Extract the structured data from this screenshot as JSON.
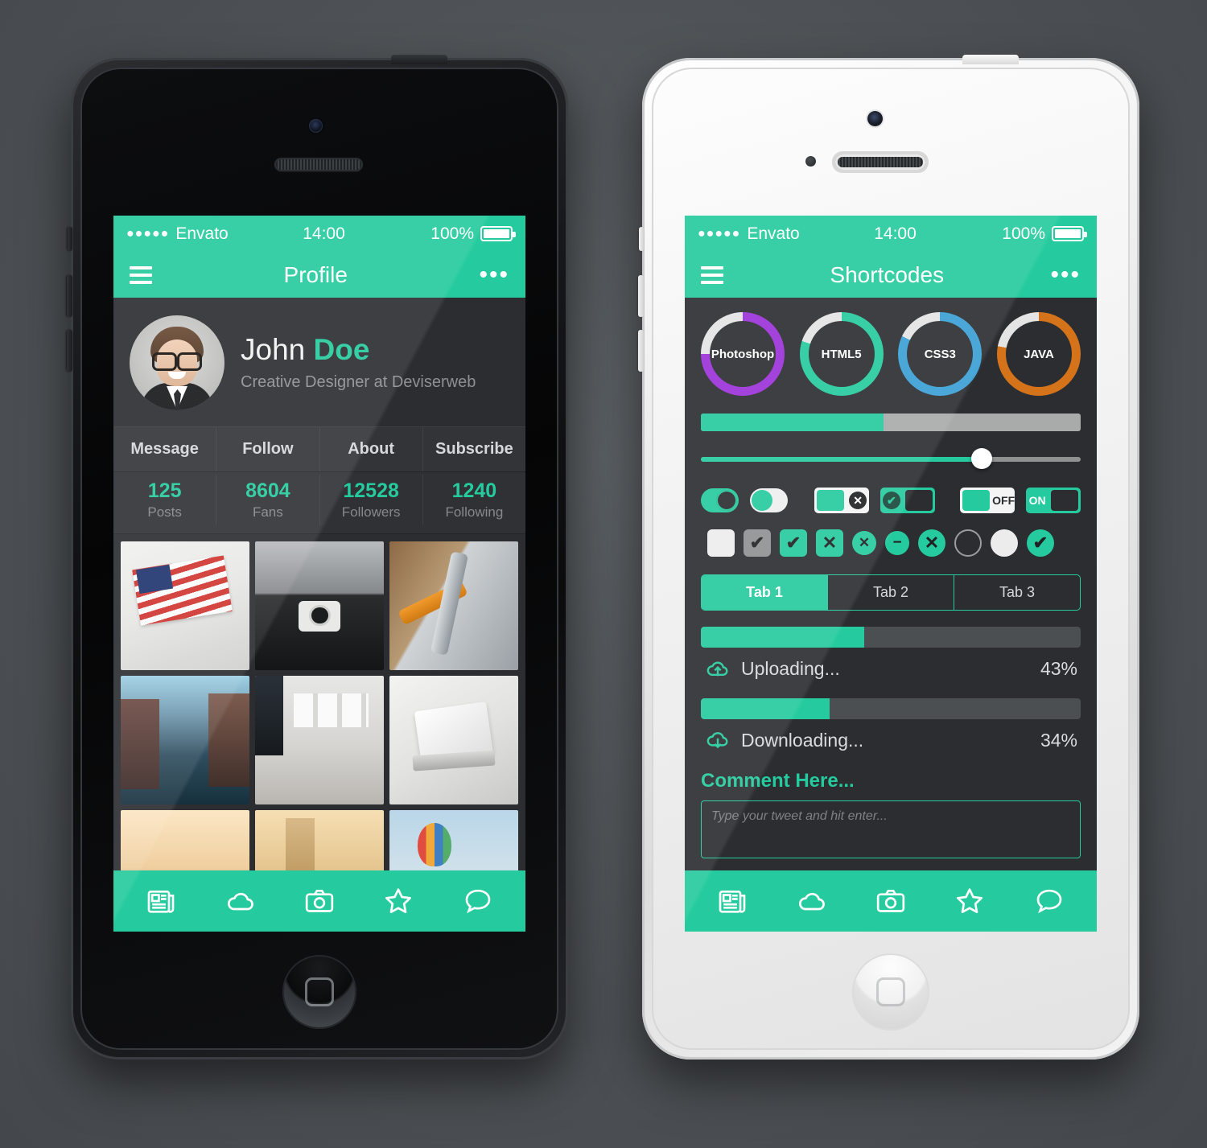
{
  "theme": {
    "accent": "#25cb9e",
    "screen_bg": "#2b2d30",
    "page_bg": "#4d5155"
  },
  "phone_left": {
    "status_bar": {
      "signal_dots": "●●●●●",
      "carrier": "Envato",
      "time": "14:00",
      "battery_pct": "100%"
    },
    "nav": {
      "menu_icon": "hamburger-icon",
      "title": "Profile",
      "more_icon": "more-dots-icon"
    },
    "profile": {
      "name_first": "John ",
      "name_last": "Doe",
      "role": "Creative Designer at Deviserweb",
      "actions": [
        "Message",
        "Follow",
        "About",
        "Subscribe"
      ],
      "stats": [
        {
          "num": "125",
          "label": "Posts"
        },
        {
          "num": "8604",
          "label": "Fans"
        },
        {
          "num": "12528",
          "label": "Followers"
        },
        {
          "num": "1240",
          "label": "Following"
        }
      ]
    },
    "photos": [
      "american-flag",
      "photographer",
      "bicycle",
      "city-street",
      "office-desk",
      "laptop-symbol",
      "crowd-sunset",
      "tower-sunset",
      "hot-air-balloon"
    ],
    "tabbar": [
      "newspaper-icon",
      "cloud-icon",
      "camera-icon",
      "star-icon",
      "chat-icon"
    ]
  },
  "phone_right": {
    "status_bar": {
      "signal_dots": "●●●●●",
      "carrier": "Envato",
      "time": "14:00",
      "battery_pct": "100%"
    },
    "nav": {
      "menu_icon": "hamburger-icon",
      "title": "Shortcodes",
      "more_icon": "more-dots-icon"
    },
    "rings": [
      {
        "label": "Photoshop",
        "percent": 75,
        "color": "#9b30d9"
      },
      {
        "label": "HTML5",
        "percent": 80,
        "color": "#25cb9e"
      },
      {
        "label": "CSS3",
        "percent": 82,
        "color": "#3a9fd4"
      },
      {
        "label": "JAVA",
        "percent": 78,
        "color": "#d4731a"
      }
    ],
    "progress_bar": {
      "percent": 48
    },
    "slider": {
      "percent": 74
    },
    "toggles": [
      {
        "type": "pill",
        "state": "on"
      },
      {
        "type": "pill",
        "state": "off"
      },
      {
        "type": "square",
        "bg": "light",
        "block": "green",
        "glyph": "✖",
        "label": ""
      },
      {
        "type": "square",
        "bg": "green",
        "block": "dark",
        "glyph": "✔",
        "label": ""
      },
      {
        "type": "square",
        "bg": "light",
        "block": "green",
        "glyph": "",
        "label": "OFF"
      },
      {
        "type": "square",
        "bg": "green",
        "block": "dark",
        "glyph": "",
        "label": "ON"
      }
    ],
    "checkboxes": [
      {
        "style": "white",
        "glyph": ""
      },
      {
        "style": "gray",
        "glyph": "✔"
      },
      {
        "style": "green",
        "glyph": "✔"
      },
      {
        "style": "green",
        "glyph": "✕"
      },
      {
        "style": "green circle",
        "glyph": "✕"
      },
      {
        "style": "green circle",
        "glyph": "−"
      },
      {
        "style": "green circle",
        "glyph": "✕"
      },
      {
        "style": "hollow circle",
        "glyph": ""
      },
      {
        "style": "whitecircle",
        "glyph": ""
      },
      {
        "style": "green circle",
        "glyph": "✔"
      }
    ],
    "tabs": [
      {
        "label": "Tab 1",
        "active": true
      },
      {
        "label": "Tab 2",
        "active": false
      },
      {
        "label": "Tab 3",
        "active": false
      }
    ],
    "uploads": [
      {
        "icon": "cloud-upload-icon",
        "text": "Uploading...",
        "pct": "43%",
        "value": 43
      },
      {
        "icon": "cloud-download-icon",
        "text": "Downloading...",
        "pct": "34%",
        "value": 34
      }
    ],
    "comment": {
      "title": "Comment Here...",
      "placeholder": "Type your tweet and hit enter..."
    },
    "tabbar": [
      "newspaper-icon",
      "cloud-icon",
      "camera-icon",
      "star-icon",
      "chat-icon"
    ]
  }
}
